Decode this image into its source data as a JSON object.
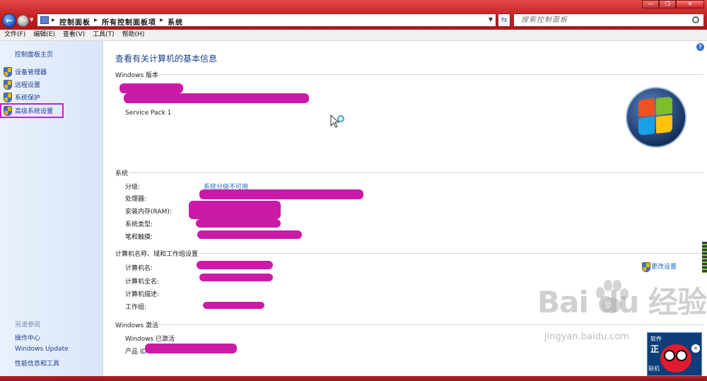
{
  "address": {
    "crumbs": [
      "控制面板",
      "所有控制面板项",
      "系统"
    ],
    "search_placeholder": "搜索控制面板"
  },
  "menu": [
    "文件(F)",
    "编辑(E)",
    "查看(V)",
    "工具(T)",
    "帮助(H)"
  ],
  "sidebar": {
    "home": "控制面板主页",
    "items": [
      "设备管理器",
      "远程设置",
      "系统保护",
      "高级系统设置"
    ],
    "see_also": "另请参阅",
    "links": [
      "操作中心",
      "Windows Update",
      "性能信息和工具"
    ]
  },
  "main": {
    "title": "查看有关计算机的基本信息",
    "edition_section": "Windows 版本",
    "service_pack": "Service Pack 1",
    "system_section": "系统",
    "system_labels": [
      "分级:",
      "处理器:",
      "安装内存(RAM):",
      "系统类型:",
      "笔和触摸:"
    ],
    "rating_value": "系统分级不可用",
    "computer_section": "计算机名称、域和工作组设置",
    "computer_labels": [
      "计算机名:",
      "计算机全名:",
      "计算机描述:",
      "工作组:"
    ],
    "change_settings": "更改设置",
    "activation_section": "Windows 激活",
    "activated": "Windows 已激活",
    "product_id_label": "产品 ID"
  },
  "watermark": {
    "text": "Bai du 经验",
    "url": "jingyan.baidu.com"
  },
  "mascot": {
    "line1": "软件",
    "line2": "正",
    "line3": "联机"
  },
  "colors": {
    "titlebar": "#c41f22",
    "link": "#1e66c6",
    "highlight": "#c81ed0",
    "redaction": "#cc1aa8"
  }
}
